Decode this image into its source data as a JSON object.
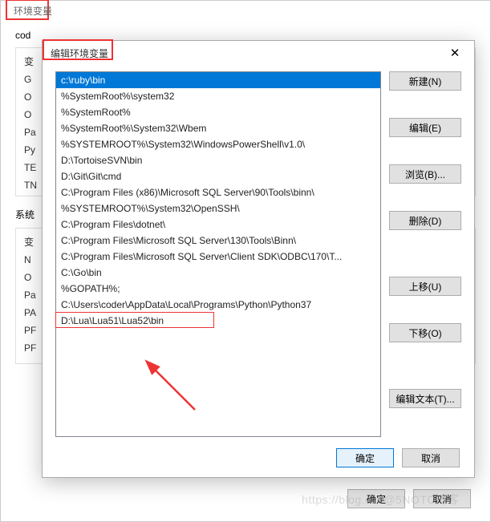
{
  "back": {
    "title": "环境变量",
    "user_label": "cod",
    "user_cols": [
      "变",
      "G",
      "O",
      "O",
      "Pa",
      "Py",
      "TE",
      "TN"
    ],
    "sys_label": "系统",
    "sys_cols": [
      "变",
      "N",
      "O",
      "Pa",
      "PA",
      "PF",
      "PF"
    ],
    "ok": "确定",
    "cancel": "取消"
  },
  "modal": {
    "title": "编辑环境变量",
    "close": "✕",
    "items": [
      "c:\\ruby\\bin",
      "%SystemRoot%\\system32",
      "%SystemRoot%",
      "%SystemRoot%\\System32\\Wbem",
      "%SYSTEMROOT%\\System32\\WindowsPowerShell\\v1.0\\",
      "D:\\TortoiseSVN\\bin",
      "D:\\Git\\Git\\cmd",
      "C:\\Program Files (x86)\\Microsoft SQL Server\\90\\Tools\\binn\\",
      "%SYSTEMROOT%\\System32\\OpenSSH\\",
      "C:\\Program Files\\dotnet\\",
      "C:\\Program Files\\Microsoft SQL Server\\130\\Tools\\Binn\\",
      "C:\\Program Files\\Microsoft SQL Server\\Client SDK\\ODBC\\170\\T...",
      "C:\\Go\\bin",
      "%GOPATH%;",
      "C:\\Users\\coder\\AppData\\Local\\Programs\\Python\\Python37",
      "D:\\Lua\\Lua51\\Lua52\\bin"
    ],
    "selected_index": 0,
    "highlight_index": 15,
    "btns": {
      "new": "新建(N)",
      "edit": "编辑(E)",
      "browse": "浏览(B)...",
      "delete": "删除(D)",
      "up": "上移(U)",
      "down": "下移(O)",
      "edit_text": "编辑文本(T)..."
    },
    "ok": "确定",
    "cancel": "取消"
  },
  "watermark": "https://blog.csd@5NOTC博客"
}
